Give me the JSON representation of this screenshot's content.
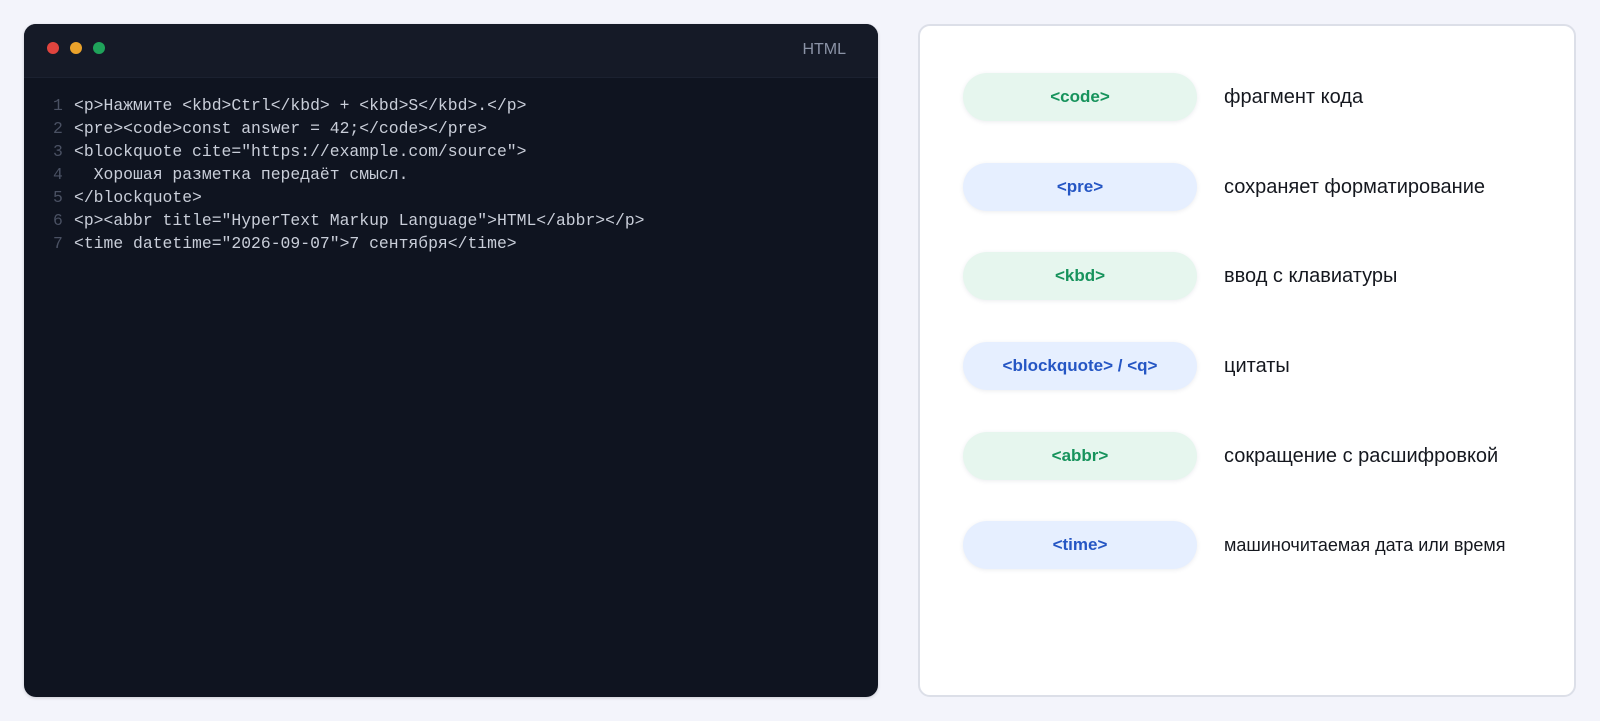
{
  "editor": {
    "language": "HTML",
    "window_dots": [
      "#e0443e",
      "#eaa22b",
      "#1fa35a"
    ],
    "lines": [
      {
        "num": "1",
        "text": "<p>Нажмите <kbd>Ctrl</kbd> + <kbd>S</kbd>.</p>"
      },
      {
        "num": "2",
        "text": "<pre><code>const answer = 42;</code></pre>"
      },
      {
        "num": "3",
        "text": "<blockquote cite=\"https://example.com/source\">"
      },
      {
        "num": "4",
        "text": "  Хорошая разметка передаёт смысл."
      },
      {
        "num": "5",
        "text": "</blockquote>"
      },
      {
        "num": "6",
        "text": "<p><abbr title=\"HyperText Markup Language\">HTML</abbr></p>"
      },
      {
        "num": "7",
        "text": "<time datetime=\"2026-09-07\">7 сентября</time>"
      }
    ]
  },
  "legend": {
    "items": [
      {
        "tag": "<code>",
        "description": "фрагмент кода",
        "style": "green"
      },
      {
        "tag": "<pre>",
        "description": "сохраняет форматирование",
        "style": "blue"
      },
      {
        "tag": "<kbd>",
        "description": "ввод с клавиатуры",
        "style": "green"
      },
      {
        "tag": "<blockquote> / <q>",
        "description": "цитаты",
        "style": "blue"
      },
      {
        "tag": "<abbr>",
        "description": "сокращение с расшифровкой",
        "style": "green"
      },
      {
        "tag": "<time>",
        "description": "машиночитаемая дата или время",
        "style": "blue"
      }
    ]
  },
  "colors": {
    "green_pill_bg": "#e6f6ee",
    "green_pill_text": "#17935c",
    "blue_pill_bg": "#e6efff",
    "blue_pill_text": "#2556c4"
  }
}
